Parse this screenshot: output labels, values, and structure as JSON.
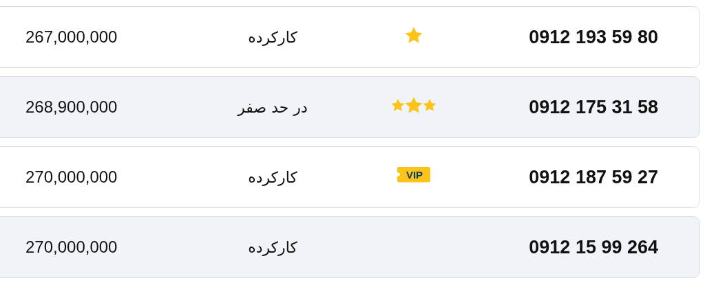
{
  "numbers": [
    {
      "price": "267,000,000",
      "condition": "کارکرده",
      "badge": {
        "kind": "star"
      },
      "number": "0912 193 59 80"
    },
    {
      "price": "268,900,000",
      "condition": "در حد صفر",
      "badge": {
        "kind": "stars",
        "stars": 3
      },
      "number": "0912 175 31 58"
    },
    {
      "price": "270,000,000",
      "condition": "کارکرده",
      "badge": {
        "kind": "vip",
        "label": "VIP"
      },
      "number": "0912 187 59 27"
    },
    {
      "price": "270,000,000",
      "condition": "کارکرده",
      "number": "0912 15 99 264"
    }
  ]
}
